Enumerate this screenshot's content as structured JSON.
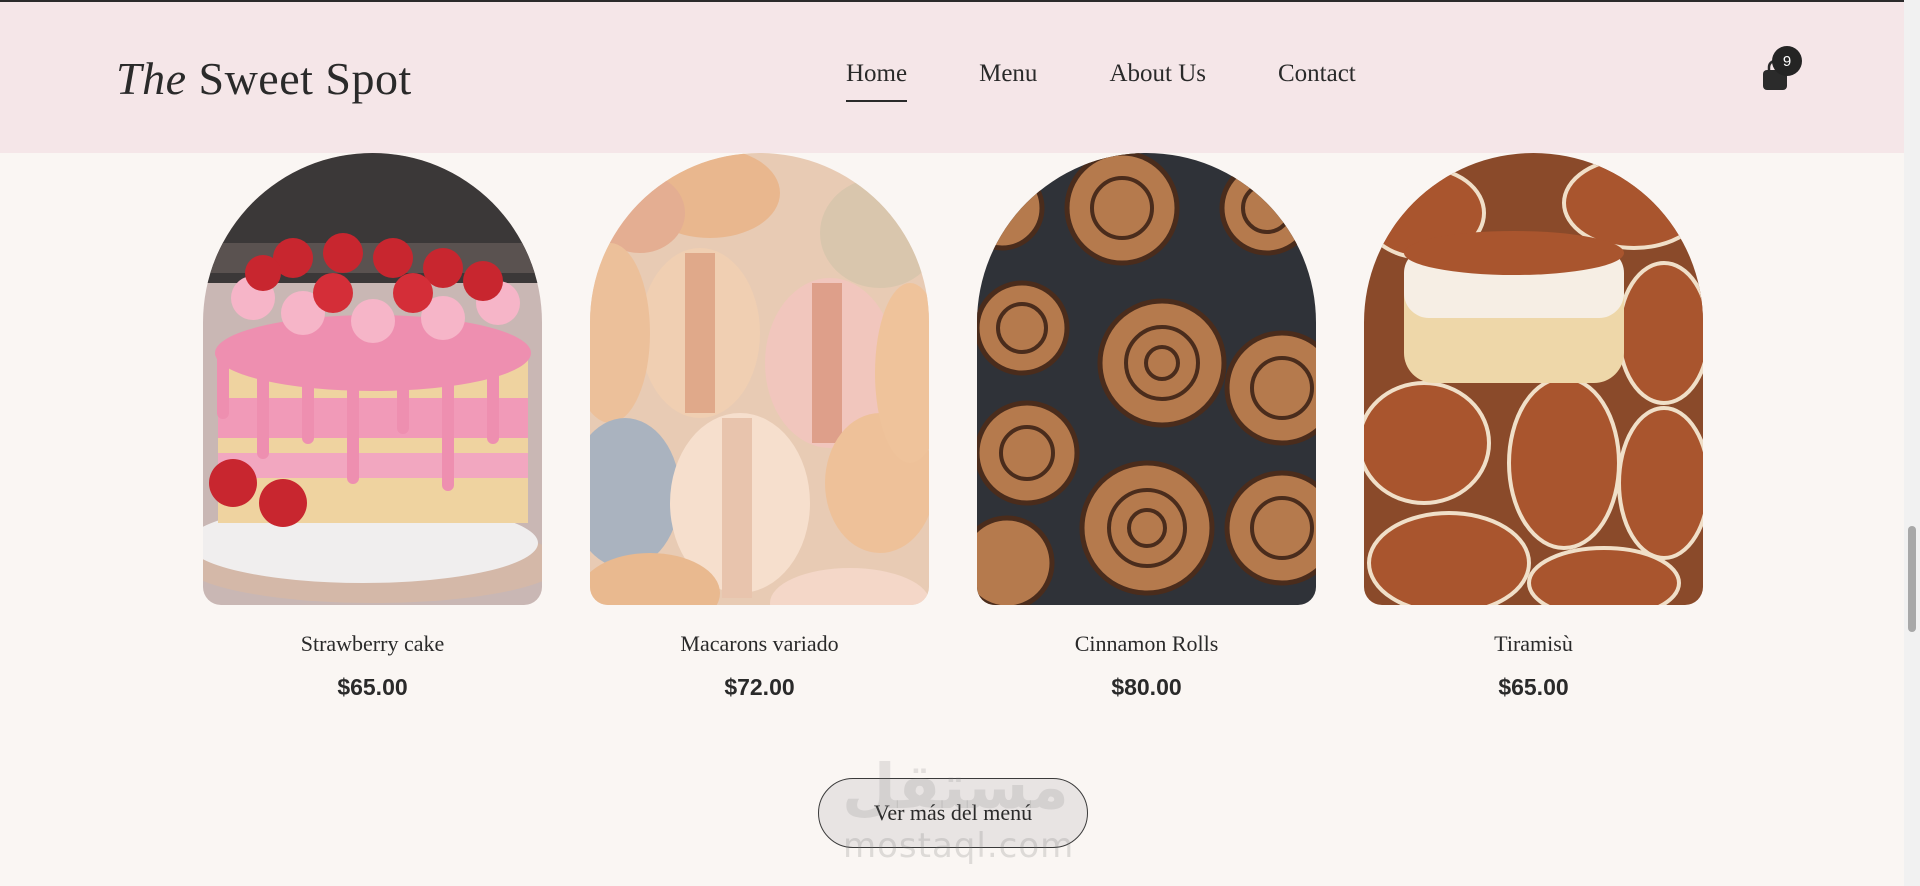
{
  "header": {
    "logo_italic": "The",
    "logo_rest": "Sweet Spot",
    "nav": [
      {
        "label": "Home"
      },
      {
        "label": "Menu"
      },
      {
        "label": "About Us"
      },
      {
        "label": "Contact"
      }
    ],
    "cart_count": "9"
  },
  "products": [
    {
      "name": "Strawberry cake",
      "price": "$65.00",
      "image": "strawberry-cake"
    },
    {
      "name": "Macarons variado",
      "price": "$72.00",
      "image": "macarons"
    },
    {
      "name": "Cinnamon Rolls",
      "price": "$80.00",
      "image": "cinnamon-rolls"
    },
    {
      "name": "Tiramisù",
      "price": "$65.00",
      "image": "tiramisu"
    }
  ],
  "more_button": "Ver más del menú",
  "watermark": {
    "arabic": "مستقل",
    "latin": "mostaql.com"
  },
  "colors": {
    "header_bg": "#f5e6e8",
    "page_bg": "#faf6f3",
    "text": "#2a2a2a"
  }
}
